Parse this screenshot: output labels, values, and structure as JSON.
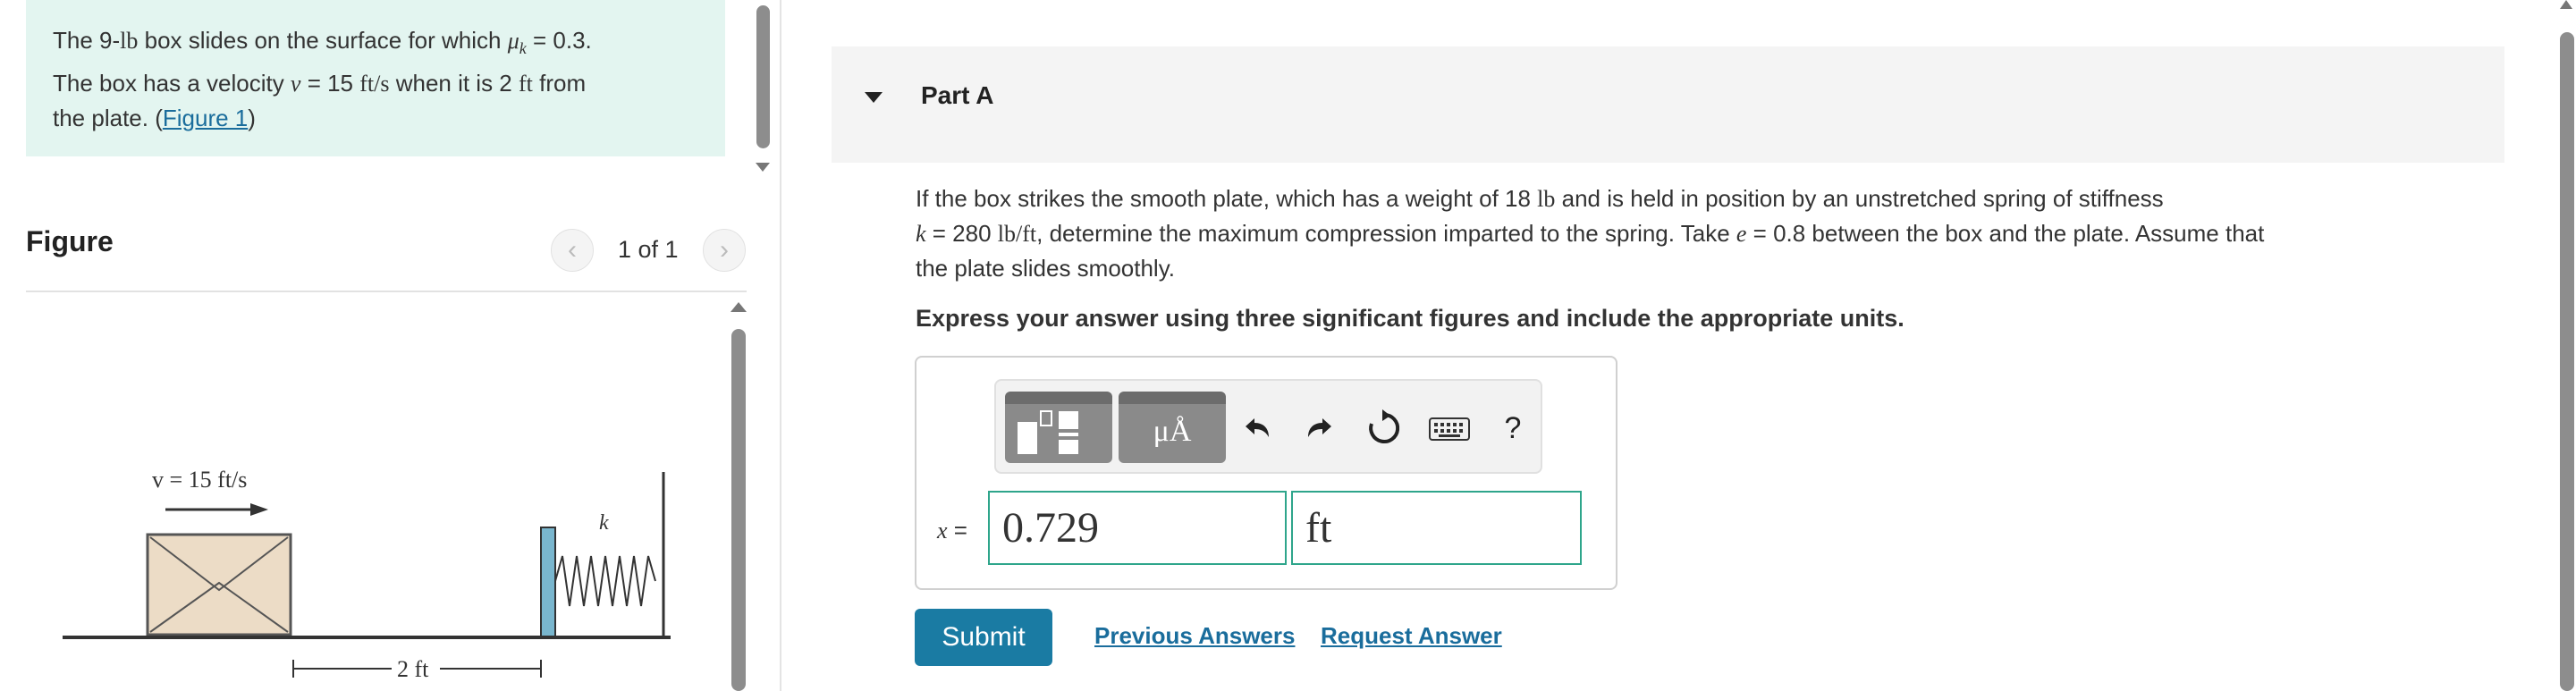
{
  "problem": {
    "t1": "The 9-",
    "weight_unit": "lb",
    "t2": " box slides on the surface for which ",
    "mu_symbol": "μ",
    "mu_sub": "k",
    "t3": " = 0.3.",
    "t4": "The box has a velocity ",
    "v_symbol": "v",
    "t5": " = 15 ",
    "speed_unit": "ft/s",
    "t6": " when it is 2 ",
    "dist_unit": "ft",
    "t7": " from",
    "t8": "the plate. (",
    "figure_link": "Figure 1",
    "t9": ")"
  },
  "figure": {
    "label": "Figure",
    "pager": "1 of 1",
    "prev_glyph": "‹",
    "next_glyph": "›",
    "velocity_label": "v = 15 ft/s",
    "spring_label": "k",
    "distance_label": "2 ft"
  },
  "part_a": {
    "title": "Part A",
    "q1": "If the box strikes the smooth plate, which has a weight of 18 ",
    "q_unit1": "lb",
    "q2": " and is held in position by an unstretched spring of stiffness",
    "q_k": "k",
    "q3": " = 280 ",
    "q_unit2": "lb/ft",
    "q4": ", determine the maximum compression imparted to the spring. Take ",
    "q_e": "e",
    "q5": " = 0.8 between the box and the plate. Assume that",
    "q6": "the plate slides smoothly.",
    "instruction": "Express your answer using three significant figures and include the appropriate units."
  },
  "answer": {
    "var": "x",
    "eq": " =",
    "value": "0.729",
    "unit": "ft",
    "units_tool_label": "μÅ",
    "help": "?"
  },
  "actions": {
    "submit": "Submit",
    "previous_answers": "Previous Answers",
    "request_answer": "Request Answer"
  }
}
